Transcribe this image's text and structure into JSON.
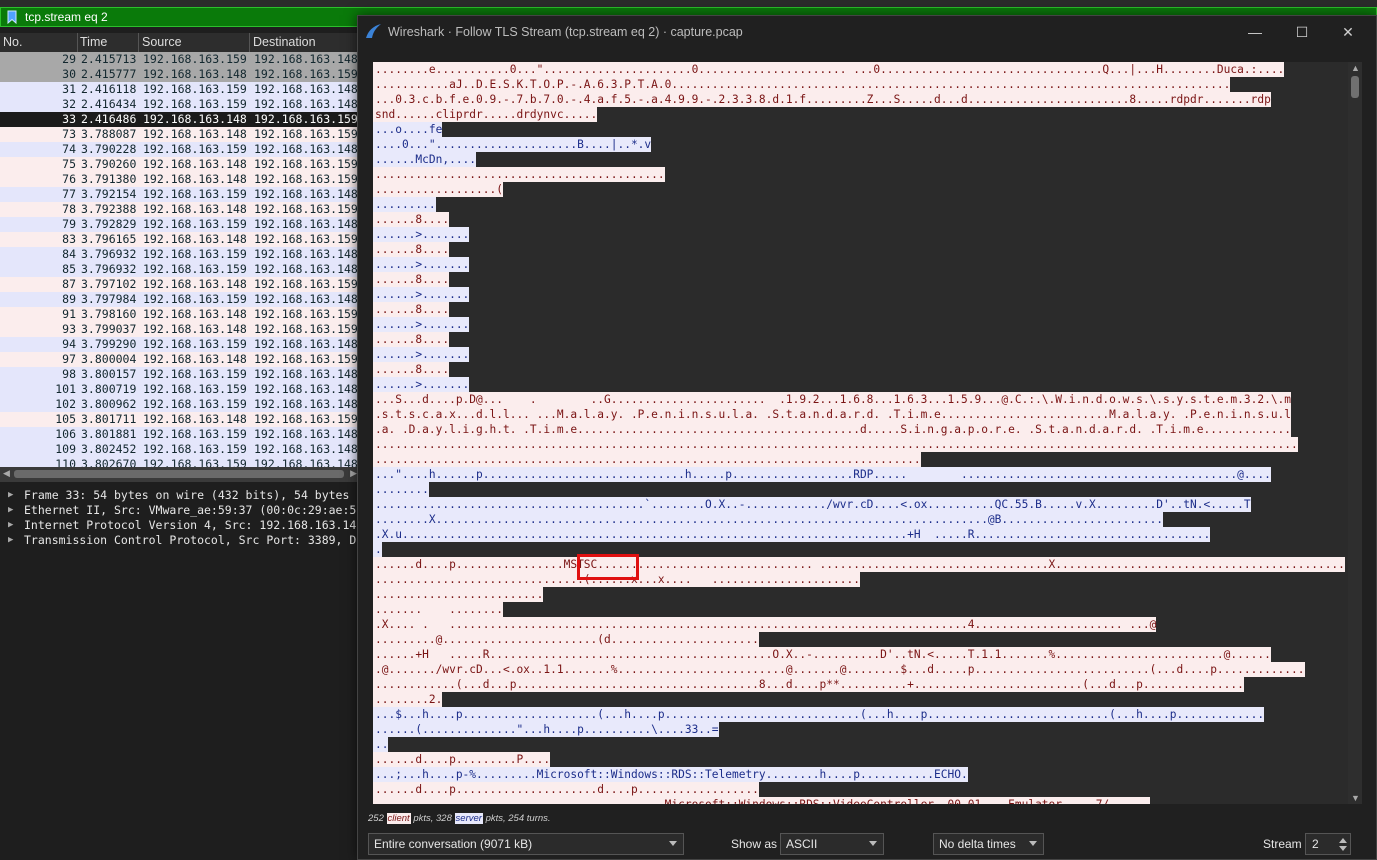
{
  "filter": {
    "value": "tcp.stream eq 2"
  },
  "packet_list": {
    "columns": [
      "No.",
      "Time",
      "Source",
      "Destination"
    ],
    "rows": [
      {
        "no": "29",
        "time": "2.415713",
        "src": "192.168.163.159",
        "dst": "192.168.163.148",
        "kind": "sel-g"
      },
      {
        "no": "30",
        "time": "2.415777",
        "src": "192.168.163.148",
        "dst": "192.168.163.159",
        "kind": "sel-g"
      },
      {
        "no": "31",
        "time": "2.416118",
        "src": "192.168.163.159",
        "dst": "192.168.163.148",
        "kind": "s"
      },
      {
        "no": "32",
        "time": "2.416434",
        "src": "192.168.163.159",
        "dst": "192.168.163.148",
        "kind": "s"
      },
      {
        "no": "33",
        "time": "2.416486",
        "src": "192.168.163.148",
        "dst": "192.168.163.159",
        "kind": "sel"
      },
      {
        "no": "73",
        "time": "3.788087",
        "src": "192.168.163.148",
        "dst": "192.168.163.159",
        "kind": "c"
      },
      {
        "no": "74",
        "time": "3.790228",
        "src": "192.168.163.159",
        "dst": "192.168.163.148",
        "kind": "s"
      },
      {
        "no": "75",
        "time": "3.790260",
        "src": "192.168.163.148",
        "dst": "192.168.163.159",
        "kind": "c"
      },
      {
        "no": "76",
        "time": "3.791380",
        "src": "192.168.163.148",
        "dst": "192.168.163.159",
        "kind": "c"
      },
      {
        "no": "77",
        "time": "3.792154",
        "src": "192.168.163.159",
        "dst": "192.168.163.148",
        "kind": "s"
      },
      {
        "no": "78",
        "time": "3.792388",
        "src": "192.168.163.148",
        "dst": "192.168.163.159",
        "kind": "c"
      },
      {
        "no": "79",
        "time": "3.792829",
        "src": "192.168.163.159",
        "dst": "192.168.163.148",
        "kind": "s"
      },
      {
        "no": "83",
        "time": "3.796165",
        "src": "192.168.163.148",
        "dst": "192.168.163.159",
        "kind": "c"
      },
      {
        "no": "84",
        "time": "3.796932",
        "src": "192.168.163.159",
        "dst": "192.168.163.148",
        "kind": "s"
      },
      {
        "no": "85",
        "time": "3.796932",
        "src": "192.168.163.159",
        "dst": "192.168.163.148",
        "kind": "s"
      },
      {
        "no": "87",
        "time": "3.797102",
        "src": "192.168.163.148",
        "dst": "192.168.163.159",
        "kind": "c"
      },
      {
        "no": "89",
        "time": "3.797984",
        "src": "192.168.163.159",
        "dst": "192.168.163.148",
        "kind": "s"
      },
      {
        "no": "91",
        "time": "3.798160",
        "src": "192.168.163.148",
        "dst": "192.168.163.159",
        "kind": "c"
      },
      {
        "no": "93",
        "time": "3.799037",
        "src": "192.168.163.148",
        "dst": "192.168.163.159",
        "kind": "c"
      },
      {
        "no": "94",
        "time": "3.799290",
        "src": "192.168.163.159",
        "dst": "192.168.163.148",
        "kind": "s"
      },
      {
        "no": "97",
        "time": "3.800004",
        "src": "192.168.163.148",
        "dst": "192.168.163.159",
        "kind": "c"
      },
      {
        "no": "98",
        "time": "3.800157",
        "src": "192.168.163.159",
        "dst": "192.168.163.148",
        "kind": "s"
      },
      {
        "no": "101",
        "time": "3.800719",
        "src": "192.168.163.159",
        "dst": "192.168.163.148",
        "kind": "s"
      },
      {
        "no": "102",
        "time": "3.800962",
        "src": "192.168.163.159",
        "dst": "192.168.163.148",
        "kind": "s"
      },
      {
        "no": "105",
        "time": "3.801711",
        "src": "192.168.163.148",
        "dst": "192.168.163.159",
        "kind": "c"
      },
      {
        "no": "106",
        "time": "3.801881",
        "src": "192.168.163.159",
        "dst": "192.168.163.148",
        "kind": "s"
      },
      {
        "no": "109",
        "time": "3.802452",
        "src": "192.168.163.159",
        "dst": "192.168.163.148",
        "kind": "s"
      },
      {
        "no": "110",
        "time": "3.802670",
        "src": "192.168.163.159",
        "dst": "192.168.163.148",
        "kind": "s"
      }
    ]
  },
  "details": [
    "Frame 33: 54 bytes on wire (432 bits), 54 bytes",
    "Ethernet II, Src: VMware_ae:59:37 (00:0c:29:ae:5",
    "Internet Protocol Version 4, Src: 192.168.163.14",
    "Transmission Control Protocol, Src Port: 3389, D"
  ],
  "dialog": {
    "title": "Wireshark · Follow TLS Stream (tcp.stream eq 2) · capture.pcap",
    "stream_lines": [
      [
        [
          "c",
          "........e...........0...\"......................0...................... ...0.................................Q...|...H........Duca.:...."
        ]
      ],
      [
        [
          "c",
          "...........aJ..D.E.S.K.T.O.P.-.A.6.3.P.T.A.0..................................................................................."
        ]
      ],
      [
        [
          "c",
          "...0.3.c.b.f.e.0.9.-.7.b.7.0.-.4.a.f.5.-.a.4.9.9.-.2.3.3.8.d.1.f.........Z...S.....d...d........................8.....rdpdr.......rdp"
        ]
      ],
      [
        [
          "c",
          "snd......cliprdr.....drdynvc....."
        ]
      ],
      [
        [
          "s",
          "...o....fe"
        ]
      ],
      [
        [
          "s",
          "....0...\".....................B....|..*.v"
        ]
      ],
      [
        [
          "s",
          "......McDn,...."
        ]
      ],
      [
        [
          "c",
          "..........................................."
        ]
      ],
      [
        [
          "c",
          "..................("
        ]
      ],
      [
        [
          "s",
          "........."
        ]
      ],
      [
        [
          "c",
          "......8...."
        ]
      ],
      [
        [
          "s",
          "......>......."
        ]
      ],
      [
        [
          "c",
          "......8...."
        ]
      ],
      [
        [
          "s",
          "......>......."
        ]
      ],
      [
        [
          "c",
          "......8...."
        ]
      ],
      [
        [
          "s",
          "......>......."
        ]
      ],
      [
        [
          "c",
          "......8...."
        ]
      ],
      [
        [
          "s",
          "......>......."
        ]
      ],
      [
        [
          "c",
          "......8...."
        ]
      ],
      [
        [
          "s",
          "......>......."
        ]
      ],
      [
        [
          "c",
          "......8...."
        ]
      ],
      [
        [
          "s",
          "......>......."
        ]
      ],
      [
        [
          "c",
          "...S...d....p.D@...    .        ..G.......................  .1.9.2...1.6.8...1.6.3...1.5.9...@.C.:.\\.W.i.n.d.o.w.s.\\.s.y.s.t.e.m.3.2.\\.m"
        ]
      ],
      [
        [
          "c",
          ".s.t.s.c.a.x...d.l.l... ...M.a.l.a.y. .P.e.n.i.n.s.u.l.a. .S.t.a.n.d.a.r.d. .T.i.m.e.........................M.a.l.a.y. .P.e.n.i.n.s.u.l"
        ]
      ],
      [
        [
          "c",
          ".a. .D.a.y.l.i.g.h.t. .T.i.m.e..........................................d.....S.i.n.g.a.p.o.r.e. .S.t.a.n.d.a.r.d. .T.i.m.e............."
        ]
      ],
      [
        [
          "c",
          "........................................................................................................................................."
        ]
      ],
      [
        [
          "c",
          "................................................................................."
        ]
      ],
      [
        [
          "s",
          "...\"....h......p..............................h.....p..................RDP.....        .........................................@...."
        ]
      ],
      [
        [
          "s",
          "........"
        ]
      ],
      [
        [
          "s",
          "........................................`........O.X..-............/wvr.cD....<.ox..........QC.55.B.....v.X.........D'..tN.<.....T"
        ]
      ],
      [
        [
          "s",
          "........X..................................................................................@B........................"
        ]
      ],
      [
        [
          "s",
          ".X.u...........................................................................+H  .....R..................................."
        ]
      ],
      [
        [
          "s",
          "."
        ]
      ],
      [
        [
          "c",
          "......d....p................MSTSC................................ ..................................X..........................................."
        ]
      ],
      [
        [
          "c",
          "...............................(......x...x....   ......................"
        ]
      ],
      [
        [
          "c",
          "........................."
        ]
      ],
      [
        [
          "c",
          ".......    ........"
        ]
      ],
      [
        [
          "c",
          ".X.... .   .............................................................................4...................... ...@"
        ]
      ],
      [
        [
          "c",
          ".........@.......................(d......................"
        ]
      ],
      [
        [
          "c",
          "......+H   .....R..........................................O.X..-..........D'..tN.<.....T.1.1.......%.........................@......"
        ]
      ],
      [
        [
          "c",
          ".@......./wvr.cD...<.ox..1.1.......%.........................@.......@........$...d.....p..........................(...d....p............."
        ]
      ],
      [
        [
          "c",
          "............(...d...p....................................8...d....p**..........+.........................(...d...p..............."
        ]
      ],
      [
        [
          "c",
          "........2."
        ]
      ],
      [
        [
          "s",
          "...$...h....p....................(...h....p.............................(...h....p...........................(...h....p............."
        ]
      ],
      [
        [
          "s",
          "......(..............\"...h....p..........\\....33..="
        ]
      ],
      [
        [
          "s",
          ".."
        ]
      ],
      [
        [
          "c",
          "......d....p.........P...."
        ]
      ],
      [
        [
          "s",
          "...;...h....p-%.........Microsoft::Windows::RDS::Telemetry........h....p...........ECHO."
        ]
      ],
      [
        [
          "c",
          "......d....p.....................d....p.................."
        ]
      ],
      [
        [
          "c",
          "...........................................Microsoft::Windows::RDS::VideoController..00.01....Emulator.....7/......"
        ]
      ]
    ],
    "highlight": "MSTSC",
    "status": {
      "pre": "252 ",
      "client_tag": "client",
      "mid": " pkts, 328 ",
      "server_tag": "server",
      "post": " pkts, 254 turns."
    },
    "conversation_select": "Entire conversation (9071 kB)",
    "show_as_label": "Show as",
    "show_as_value": "ASCII",
    "delta_select": "No delta times",
    "stream_label": "Stream",
    "stream_value": "2",
    "colors": {
      "client_bg": "#fbeded",
      "client_fg": "#7a1414",
      "server_bg": "#e8e9fb",
      "server_fg": "#1c2d8a",
      "filter_bg": "#0a7a0a"
    }
  }
}
